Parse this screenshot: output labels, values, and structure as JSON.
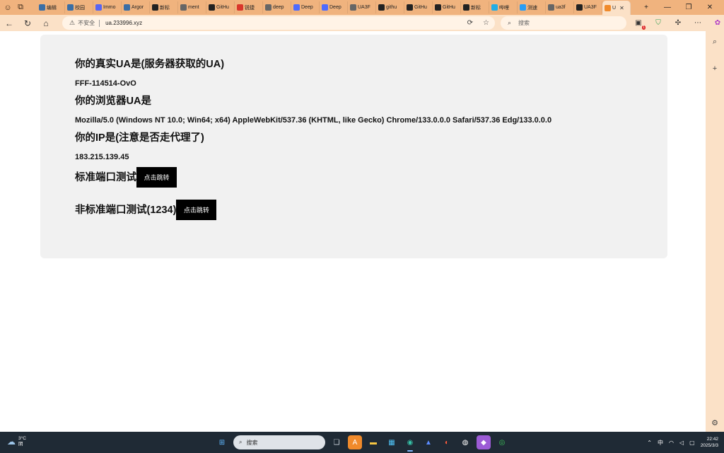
{
  "browser": {
    "tabs": [
      {
        "label": "编辑",
        "color": "#3a6ea5"
      },
      {
        "label": "校园",
        "color": "#3a6ea5"
      },
      {
        "label": "Immo",
        "color": "#5865f2"
      },
      {
        "label": "Argor",
        "color": "#3a6ea5"
      },
      {
        "label": "新标",
        "color": "#222222"
      },
      {
        "label": "ment",
        "color": "#666666"
      },
      {
        "label": "GitHu",
        "color": "#222222"
      },
      {
        "label": "锐捷",
        "color": "#d9372b"
      },
      {
        "label": "deep",
        "color": "#666666"
      },
      {
        "label": "Deep",
        "color": "#4d6bfe"
      },
      {
        "label": "Deep",
        "color": "#4d6bfe"
      },
      {
        "label": "UA3F",
        "color": "#666666"
      },
      {
        "label": "githu",
        "color": "#222222"
      },
      {
        "label": "GitHu",
        "color": "#222222"
      },
      {
        "label": "GitHu",
        "color": "#222222"
      },
      {
        "label": "新标",
        "color": "#222222"
      },
      {
        "label": "哔哩",
        "color": "#23ade5"
      },
      {
        "label": "测速",
        "color": "#2a9df4"
      },
      {
        "label": "ua3f",
        "color": "#666666"
      },
      {
        "label": "UA3F",
        "color": "#222222"
      },
      {
        "label": "U",
        "color": "#f08a2b"
      }
    ],
    "address": {
      "insecure_label": "不安全",
      "url": "ua.233996.xyz"
    },
    "search_placeholder": "搜索",
    "extension_badge": "1"
  },
  "page": {
    "real_ua_heading": "你的真实UA是(服务器获取的UA)",
    "real_ua_value": "FFF-114514-OvO",
    "browser_ua_heading": "你的浏览器UA是",
    "browser_ua_value": "Mozilla/5.0 (Windows NT 10.0; Win64; x64) AppleWebKit/537.36 (KHTML, like Gecko) Chrome/133.0.0.0 Safari/537.36 Edg/133.0.0.0",
    "ip_heading": "你的IP是(注意是否走代理了)",
    "ip_value": "183.215.139.45",
    "std_port_heading": "标准端口测试",
    "std_port_button": "点击跳转",
    "nonstd_port_heading": "非标准端口测试(1234)",
    "nonstd_port_button": "点击跳转"
  },
  "taskbar": {
    "weather_temp": "3°C",
    "weather_desc": "阴",
    "search_placeholder": "搜索",
    "ime": "中",
    "time": "22:42",
    "date": "2025/3/3"
  }
}
